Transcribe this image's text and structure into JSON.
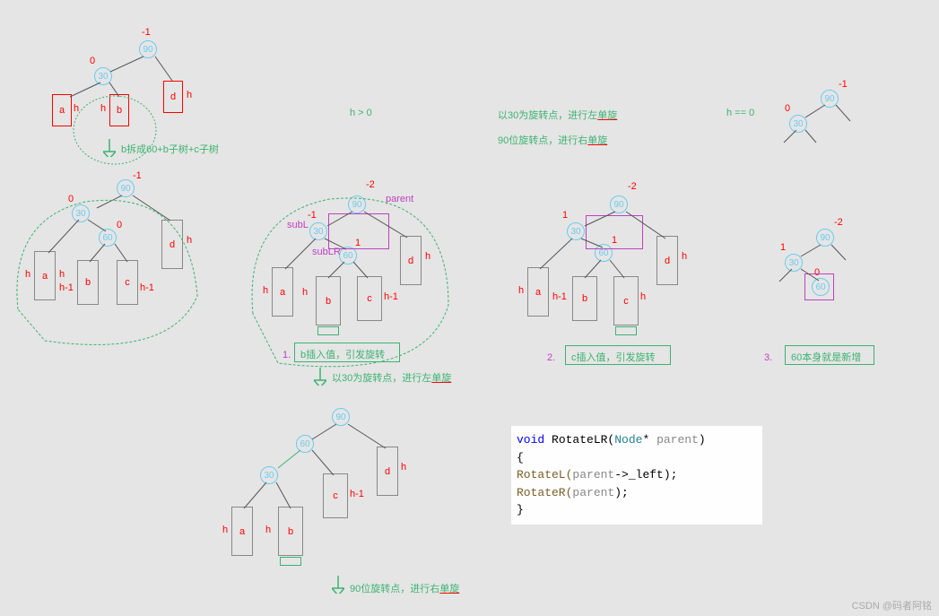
{
  "tree1": {
    "n90": "90",
    "n30": "30",
    "b90": "-1",
    "b30": "0",
    "a": "a",
    "b": "b",
    "d": "d",
    "ha1": "h",
    "ha2": "h",
    "hb1": "h",
    "hd": "h",
    "note": "b拆成60+b子树+c子树"
  },
  "tree2": {
    "n90": "90",
    "n30": "30",
    "n60": "60",
    "b90": "-1",
    "b30": "0",
    "b60": "0",
    "a": "a",
    "b": "b",
    "c": "c",
    "d": "d",
    "ha1": "h",
    "ha2": "h",
    "hb": "h-1",
    "hc": "h-1",
    "hd": "h"
  },
  "headers": {
    "hg0": "h > 0",
    "rot30L": "以30为旋转点，进行左单旋",
    "rot90R": "90位旋转点，进行右单旋",
    "he0": "h == 0"
  },
  "simpleTree": {
    "n90": "90",
    "n30": "30",
    "b90": "-1",
    "b30": "0"
  },
  "tree3": {
    "n90": "90",
    "n30": "30",
    "n60": "60",
    "b90": "-2",
    "b30": "-1",
    "b60": "1",
    "parent": "parent",
    "subL": "subL",
    "subLR": "subLR",
    "a": "a",
    "b": "b",
    "c": "c",
    "d": "d",
    "ha": "h",
    "hb": "h",
    "hc": "h-1",
    "hd": "h",
    "note_b": "b插入值，引发旋转",
    "note_rot": "以30为旋转点，进行左单旋",
    "num1": "1."
  },
  "tree4": {
    "n90": "90",
    "n30": "30",
    "n60": "60",
    "b90": "-2",
    "b30": "1",
    "b60": "1",
    "a": "a",
    "b": "b",
    "c": "c",
    "d": "d",
    "ha": "h",
    "hb": "h-1",
    "hc": "h",
    "hd": "h",
    "note_c": "c插入值，引发旋转",
    "num2": "2."
  },
  "treeH0": {
    "n90": "90",
    "n30": "30",
    "n60": "60",
    "b90": "-2",
    "b30": "1",
    "b60": "0",
    "note60": "60本身就是新增",
    "num3": "3."
  },
  "tree5": {
    "n90": "90",
    "n60": "60",
    "n30": "30",
    "a": "a",
    "b": "b",
    "c": "c",
    "d": "d",
    "ha1": "h",
    "ha2": "h",
    "hb": "h",
    "hc": "h-1",
    "hd": "h",
    "note_rot": "90位旋转点，进行右单旋"
  },
  "code": {
    "l1a": "void",
    "l1b": " RotateLR(",
    "l1c": "Node",
    "l1d": "* ",
    "l1e": "parent",
    "l1f": ")",
    "l2": "{",
    "l3a": "    RotateL(",
    "l3b": "parent",
    "l3c": "->_left);",
    "l4a": "    RotateR(",
    "l4b": "parent",
    "l4c": ");",
    "l5": "}"
  },
  "watermark": "CSDN @码者阿铭"
}
